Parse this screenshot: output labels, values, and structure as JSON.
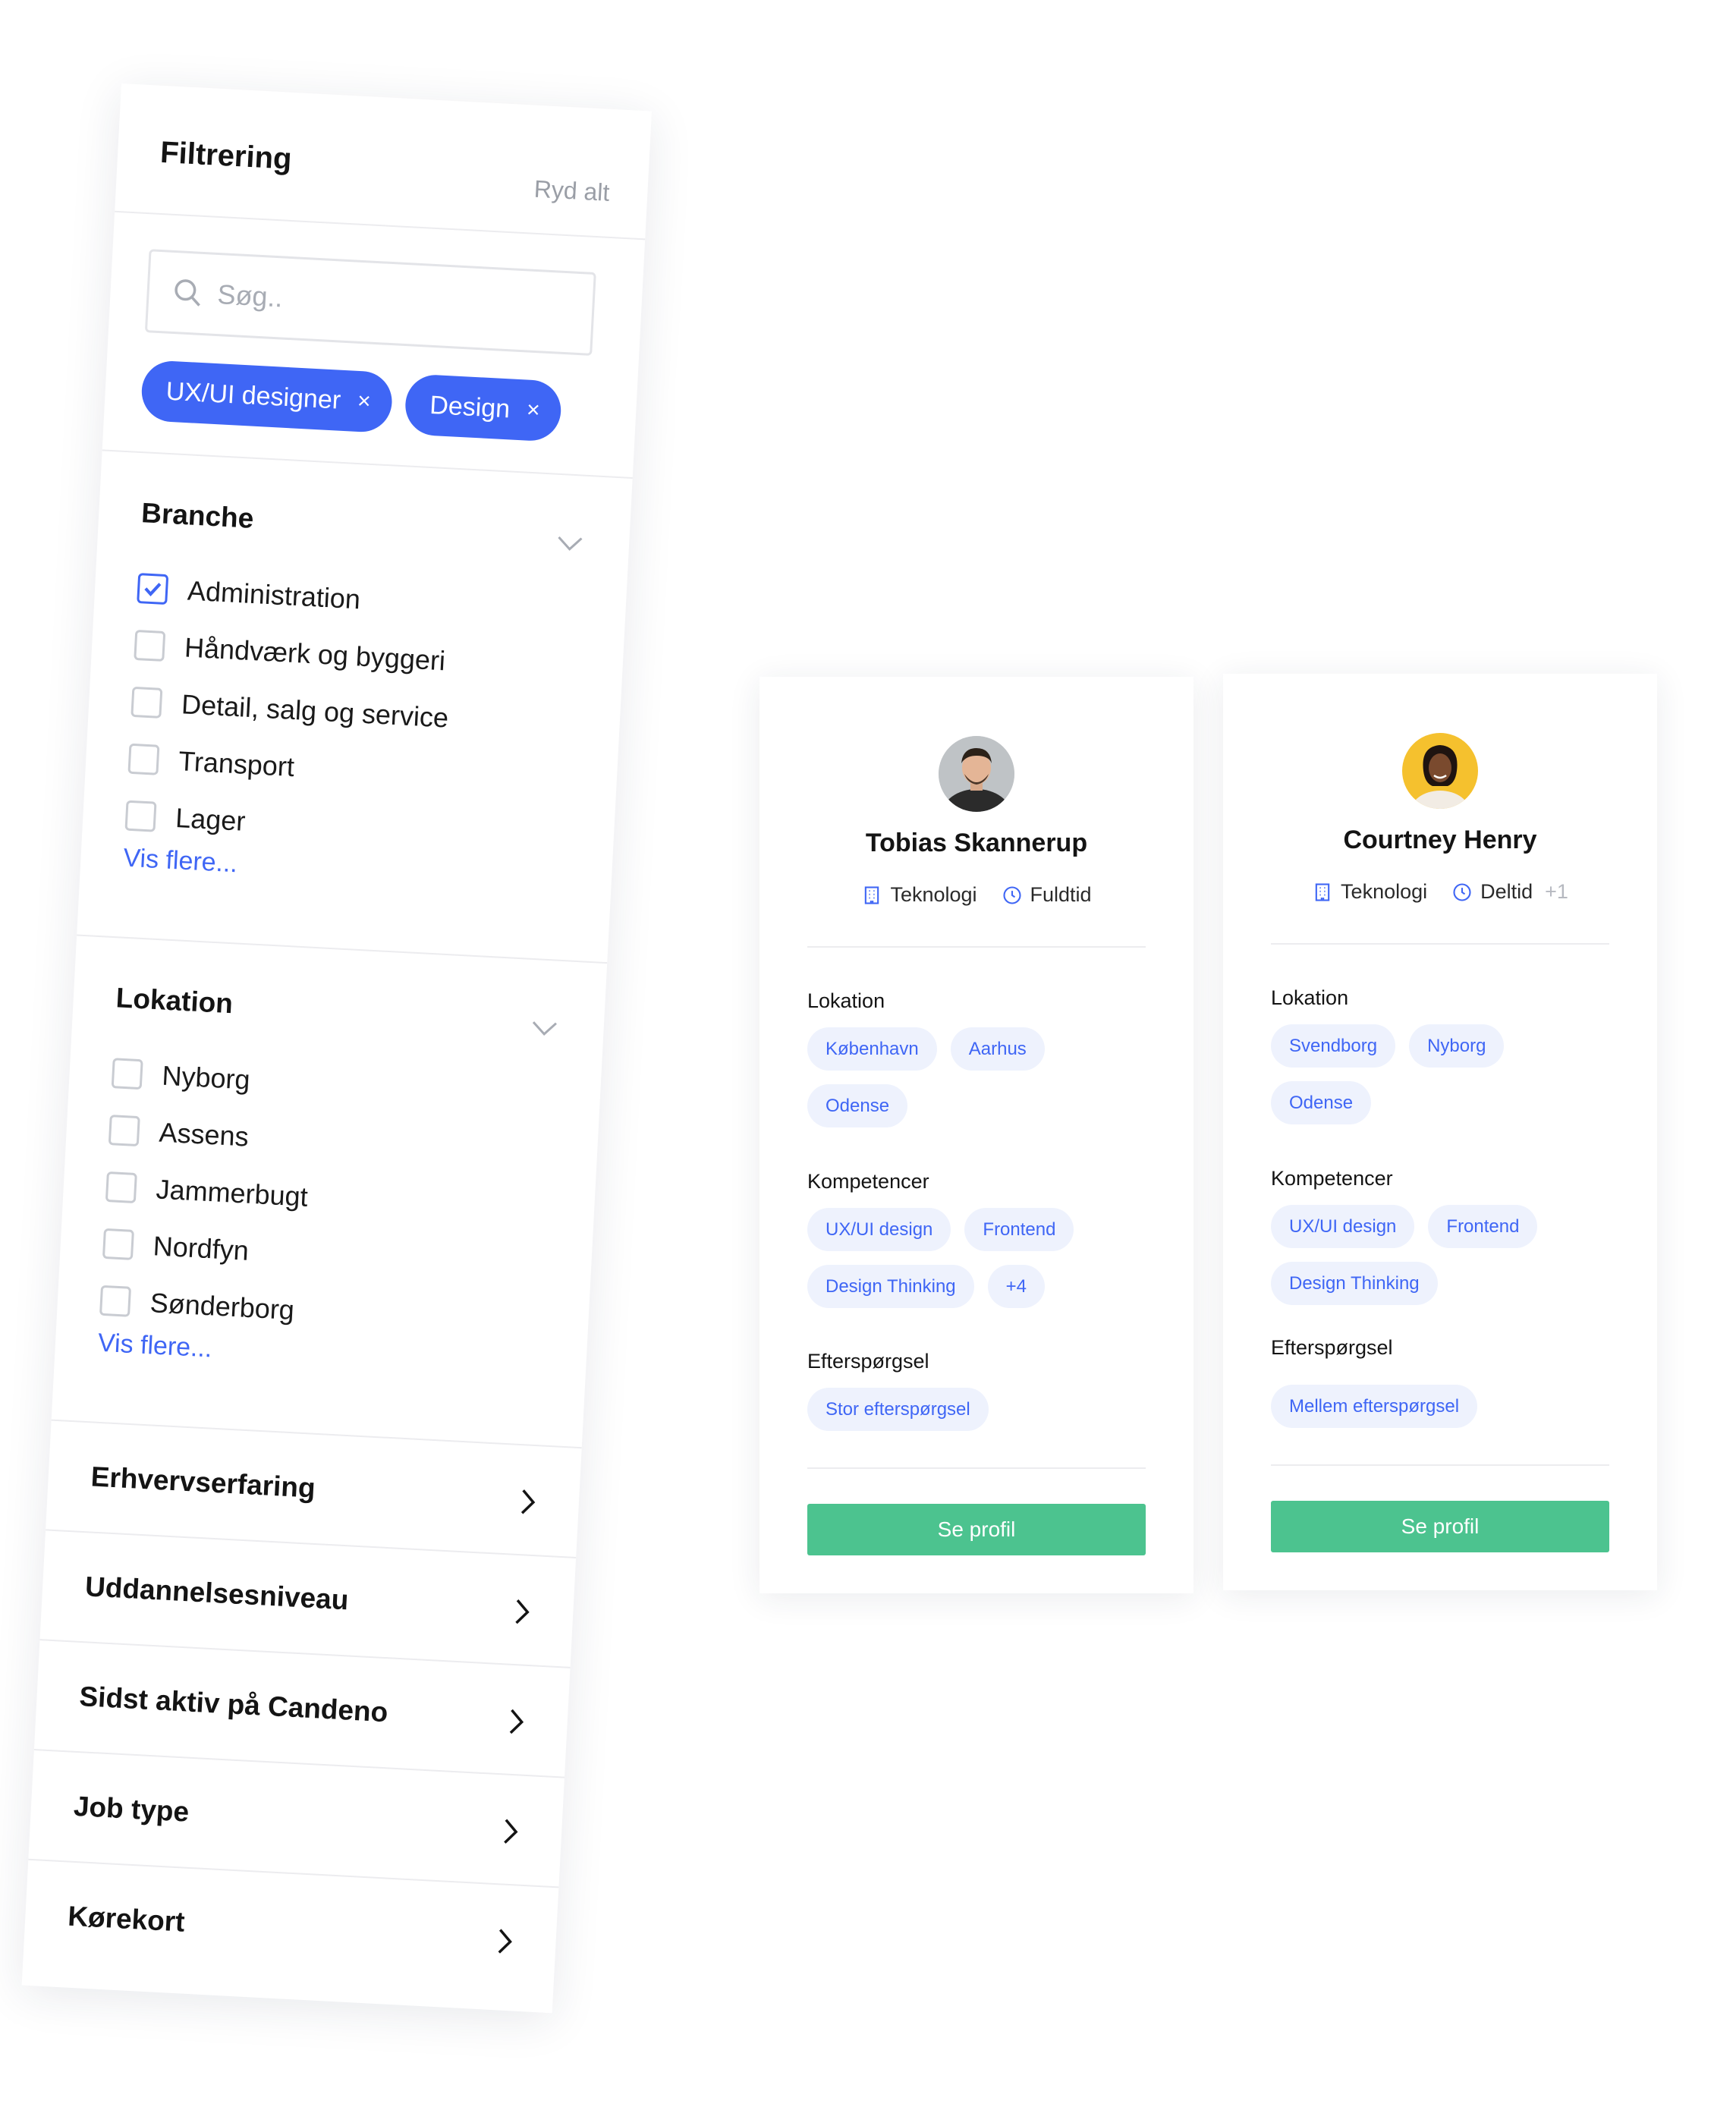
{
  "filter": {
    "title": "Filtrering",
    "clear_all": "Ryd alt",
    "search": {
      "placeholder": "Søg..",
      "value": ""
    },
    "chips": [
      {
        "label": "UX/UI designer",
        "close": "×"
      },
      {
        "label": "Design",
        "close": "×"
      }
    ],
    "branche": {
      "title": "Branche",
      "options": [
        {
          "label": "Administration",
          "checked": true
        },
        {
          "label": "Håndværk og byggeri",
          "checked": false
        },
        {
          "label": "Detail, salg og service",
          "checked": false
        },
        {
          "label": "Transport",
          "checked": false
        },
        {
          "label": "Lager",
          "checked": false
        }
      ],
      "more": "Vis flere..."
    },
    "lokation": {
      "title": "Lokation",
      "options": [
        {
          "label": "Nyborg",
          "checked": false
        },
        {
          "label": "Assens",
          "checked": false
        },
        {
          "label": "Jammerbugt",
          "checked": false
        },
        {
          "label": "Nordfyn",
          "checked": false
        },
        {
          "label": "Sønderborg",
          "checked": false
        }
      ],
      "more": "Vis flere..."
    },
    "rows": [
      {
        "label": "Erhvervserfaring"
      },
      {
        "label": "Uddannelsesniveau"
      },
      {
        "label": "Sidst aktiv på Candeno"
      },
      {
        "label": "Job type"
      },
      {
        "label": "Kørekort"
      }
    ]
  },
  "cards": [
    {
      "name": "Tobias Skannerup",
      "industry": "Teknologi",
      "job_type": "Fuldtid",
      "job_type_extra": "",
      "location_title": "Lokation",
      "locations": [
        "København",
        "Aarhus",
        "Odense"
      ],
      "skills_title": "Kompetencer",
      "skills": [
        "UX/UI design",
        "Frontend",
        "Design Thinking",
        "+4"
      ],
      "demand_title": "Efterspørgsel",
      "demand": [
        "Stor efterspørgsel"
      ],
      "button": "Se profil",
      "avatar_color": "#3a3a3a"
    },
    {
      "name": "Courtney Henry",
      "industry": "Teknologi",
      "job_type": "Deltid",
      "job_type_extra": "+1",
      "location_title": "Lokation",
      "locations": [
        "Svendborg",
        "Nyborg",
        "Odense"
      ],
      "skills_title": "Kompetencer",
      "skills": [
        "UX/UI design",
        "Frontend",
        "Design Thinking"
      ],
      "demand_title": "Efterspørgsel",
      "demand": [
        "Mellem efterspørgsel"
      ],
      "button": "Se profil",
      "avatar_color": "#f5c12e"
    }
  ],
  "colors": {
    "accent": "#3f66f5",
    "button": "#4cc38f",
    "tag_bg": "#eef2fd",
    "divider": "#ececef"
  }
}
